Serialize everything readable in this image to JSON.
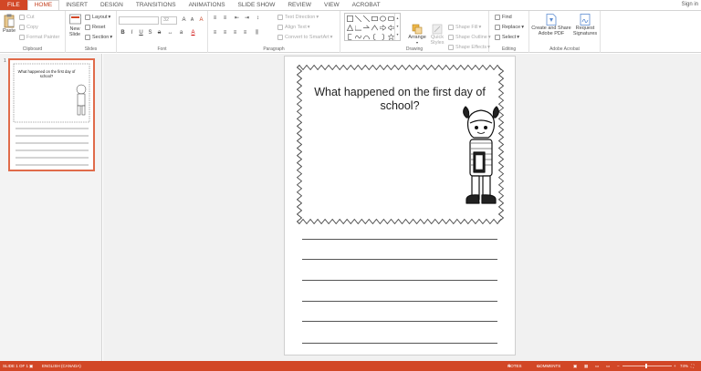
{
  "ribbon_tabs": [
    "FILE",
    "HOME",
    "INSERT",
    "DESIGN",
    "TRANSITIONS",
    "ANIMATIONS",
    "SLIDE SHOW",
    "REVIEW",
    "VIEW",
    "ACROBAT"
  ],
  "active_tab": "HOME",
  "sign_in": "Sign in",
  "clipboard": {
    "paste": "Paste",
    "cut": "Cut",
    "copy": "Copy",
    "format_painter": "Format Painter",
    "label": "Clipboard"
  },
  "slides": {
    "new_slide": "New",
    "new_slide_2": "Slide",
    "layout": "Layout",
    "reset": "Reset",
    "section": "Section",
    "label": "Slides"
  },
  "font": {
    "size": "32",
    "label": "Font"
  },
  "paragraph": {
    "text_direction": "Text Direction",
    "align_text": "Align Text",
    "convert_smartart": "Convert to SmartArt",
    "label": "Paragraph"
  },
  "drawing": {
    "arrange": "Arrange",
    "quick_styles": "Quick",
    "quick_styles_2": "Styles",
    "shape_fill": "Shape Fill",
    "shape_outline": "Shape Outline",
    "shape_effects": "Shape Effects",
    "label": "Drawing"
  },
  "editing": {
    "find": "Find",
    "replace": "Replace",
    "select": "Select",
    "label": "Editing"
  },
  "acrobat": {
    "create_share": "Create and Share",
    "create_share_2": "Adobe PDF",
    "request_signatures": "Request",
    "request_signatures_2": "Signatures",
    "label": "Adobe Acrobat"
  },
  "thumbnail": {
    "number": "1",
    "title": "What happened on the first day of school?"
  },
  "slide": {
    "question": "What happened on the first day of school?"
  },
  "status": {
    "slide_count": "SLIDE 1 OF 1",
    "language": "ENGLISH (CANADA)",
    "notes": "NOTES",
    "comments": "COMMENTS",
    "zoom": "74%"
  },
  "colors": {
    "accent": "#d24726",
    "thumbnail_border": "#e06b4a"
  }
}
